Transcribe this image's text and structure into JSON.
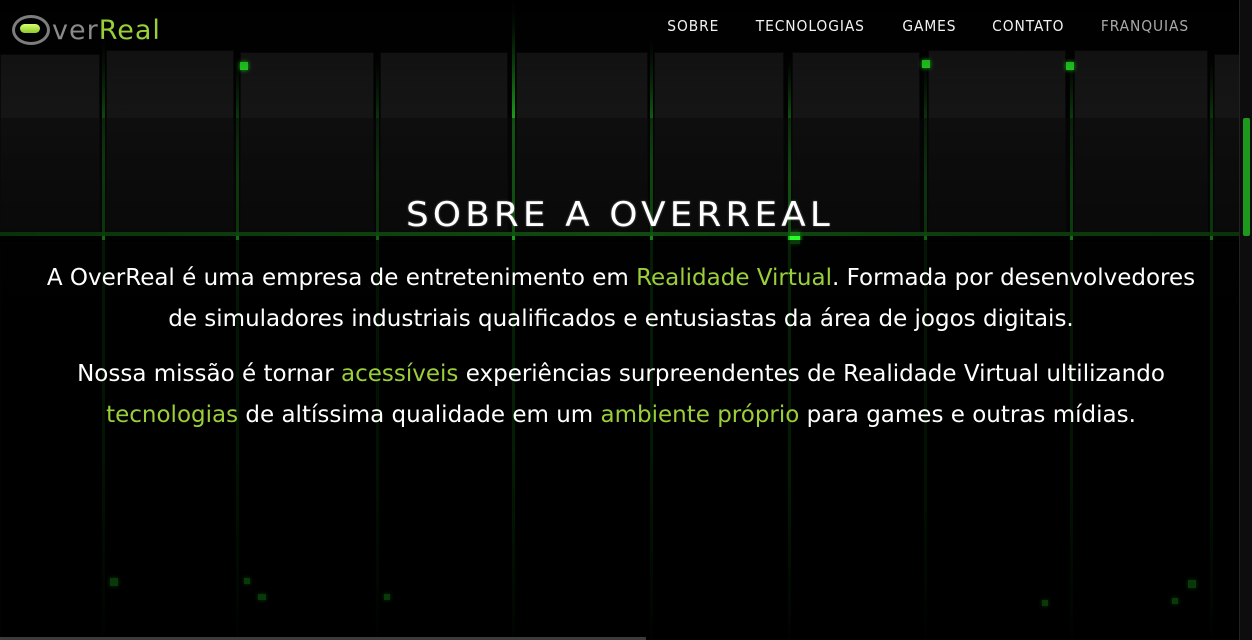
{
  "logo": {
    "text_prefix": "O",
    "text_mid": "ver",
    "text_accent": "Real"
  },
  "nav": {
    "items": [
      {
        "label": "SOBRE"
      },
      {
        "label": "TECNOLOGIAS"
      },
      {
        "label": "GAMES"
      },
      {
        "label": "CONTATO"
      },
      {
        "label": "FRANQUIAS"
      }
    ]
  },
  "section": {
    "title": "SOBRE A OVERREAL",
    "p1": {
      "a": "A OverReal é uma empresa de entretenimento em ",
      "hl1": "Realidade Virtual",
      "b": ". Formada por desenvolvedores de simuladores industriais qualificados e entusiastas da área de jogos digitais."
    },
    "p2": {
      "a": "Nossa missão é tornar ",
      "hl1": "acessíveis",
      "b": " experiências surpreendentes de Realidade Virtual ultilizando ",
      "hl2": "tecnologias",
      "c": " de altíssima qualidade em um ",
      "hl3": "ambiente próprio",
      "d": " para games e outras mídias."
    }
  },
  "colors": {
    "accent": "#9bcf3a",
    "grid_glow": "#22c722",
    "background": "#000000",
    "text": "#ffffff"
  }
}
